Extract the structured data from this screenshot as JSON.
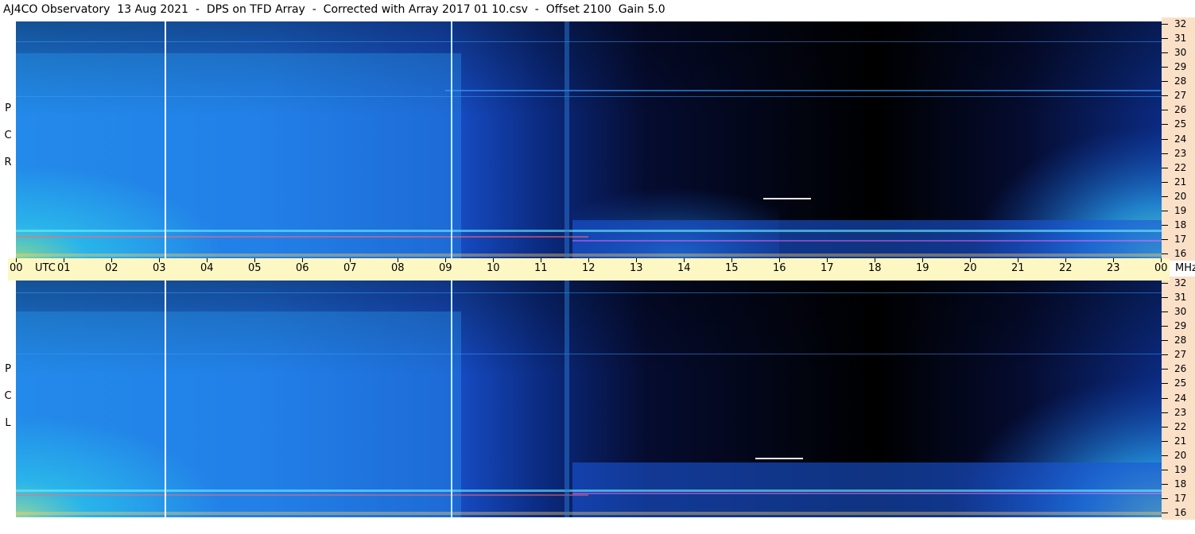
{
  "title": "AJ4CO Observatory  13 Aug 2021  -  DPS on TFD Array  -  Corrected with Array 2017 01 10.csv  -  Offset 2100  Gain 5.0",
  "panels": [
    {
      "id": "rcp",
      "label_letters": [
        "R",
        "C",
        "P"
      ]
    },
    {
      "id": "lcp",
      "label_letters": [
        "L",
        "C",
        "P"
      ]
    }
  ],
  "freq_axis": {
    "unit": "MHz",
    "ticks": [
      "32",
      "31",
      "30",
      "29",
      "28",
      "27",
      "26",
      "25",
      "24",
      "23",
      "22",
      "21",
      "20",
      "19",
      "18",
      "17",
      "16"
    ]
  },
  "time_axis": {
    "labels": [
      "00",
      "UTC",
      "01",
      "02",
      "03",
      "04",
      "05",
      "06",
      "07",
      "08",
      "09",
      "10",
      "11",
      "12",
      "13",
      "14",
      "15",
      "16",
      "17",
      "18",
      "19",
      "20",
      "21",
      "22",
      "23",
      "00",
      "MHz"
    ]
  },
  "colors": {
    "background_dark": "#000000",
    "deep_blue": "#0a1e6e",
    "mid_blue": "#1a56d8",
    "cyan": "#21c8f0",
    "green_yellow": "#b8f060",
    "marker_line": "#ffffff",
    "axis_bg": "#fbe0c8",
    "utc_bg": "#fdf7c3"
  }
}
